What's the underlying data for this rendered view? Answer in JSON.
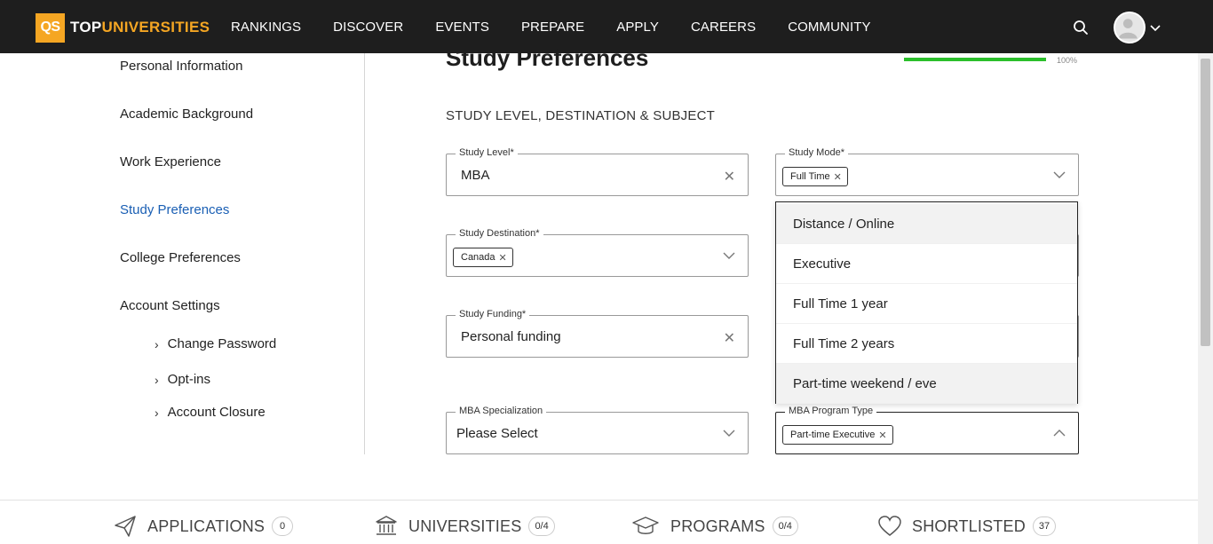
{
  "header": {
    "logo_qs": "QS",
    "logo_top": "TOP",
    "logo_universities": "UNIVERSITIES",
    "nav": [
      "RANKINGS",
      "DISCOVER",
      "EVENTS",
      "PREPARE",
      "APPLY",
      "CAREERS",
      "COMMUNITY"
    ],
    "icons": [
      "search-icon",
      "avatar",
      "chevron-down-icon"
    ]
  },
  "sidebar": {
    "items": [
      {
        "label": "Personal Information"
      },
      {
        "label": "Academic Background"
      },
      {
        "label": "Work Experience"
      },
      {
        "label": "Study Preferences",
        "active": true
      },
      {
        "label": "College Preferences"
      },
      {
        "label": "Account Settings"
      }
    ],
    "subitems": [
      {
        "label": "Change Password"
      },
      {
        "label": "Opt-ins"
      },
      {
        "label": "Account Closure"
      }
    ]
  },
  "main": {
    "title": "Study Preferences",
    "progress": {
      "value": 1.0,
      "label": "100%"
    },
    "section_title": "STUDY LEVEL, DESTINATION & SUBJECT",
    "study_level": {
      "label": "Study Level*",
      "value": "MBA"
    },
    "study_mode": {
      "label": "Study Mode*",
      "chip": "Full Time"
    },
    "study_destination": {
      "label": "Study Destination*",
      "chip": "Canada"
    },
    "study_funding": {
      "label": "Study Funding*",
      "value": "Personal funding"
    },
    "mba_specialization": {
      "label": "MBA Specialization",
      "value": "Please Select"
    },
    "mba_program_type": {
      "label": "MBA Program Type",
      "chip": "Part-time Executive"
    }
  },
  "dropdown": {
    "options": [
      "Distance / Online",
      "Executive",
      "Full Time 1 year",
      "Full Time 2 years",
      "Part-time weekend / eve"
    ]
  },
  "footer": {
    "items": [
      {
        "label": "APPLICATIONS",
        "count": "0",
        "icon": "paper-plane-icon"
      },
      {
        "label": "UNIVERSITIES",
        "count": "0/4",
        "icon": "university-icon"
      },
      {
        "label": "PROGRAMS",
        "count": "0/4",
        "icon": "graduation-cap-icon"
      },
      {
        "label": "SHORTLISTED",
        "count": "37",
        "icon": "heart-icon"
      }
    ]
  },
  "colors": {
    "header_bg": "#1e1e1e",
    "brand_orange": "#f5a623",
    "active_link": "#1a5fb4",
    "progress_green": "#2bbf2b"
  }
}
